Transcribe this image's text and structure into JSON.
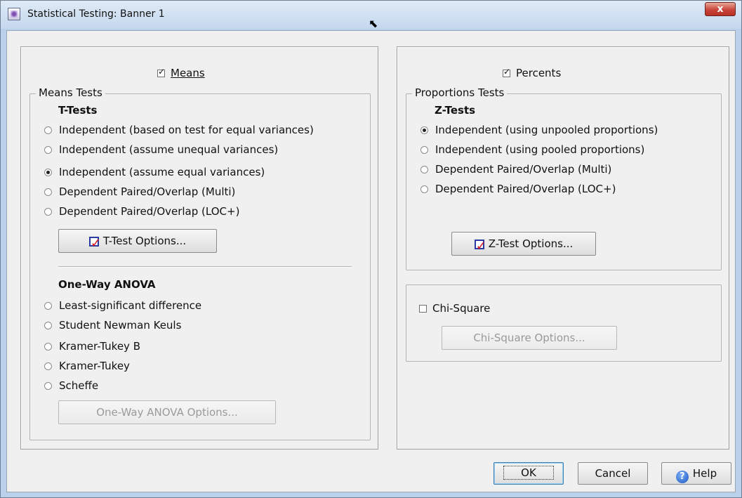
{
  "window": {
    "title": "Statistical Testing: Banner 1",
    "close_label": "x"
  },
  "means": {
    "checkbox_label": "Means",
    "checked": true,
    "group_title": "Means Tests",
    "ttests": {
      "heading": "T-Tests",
      "options": [
        {
          "label": "Independent (based on test for equal variances)",
          "selected": false
        },
        {
          "label": "Independent (assume unequal variances)",
          "selected": false
        },
        {
          "label": "Independent (assume equal variances)",
          "selected": true
        },
        {
          "label": "Dependent Paired/Overlap (Multi)",
          "selected": false
        },
        {
          "label": "Dependent Paired/Overlap (LOC+)",
          "selected": false
        }
      ],
      "options_button": "T-Test Options..."
    },
    "anova": {
      "heading": "One-Way ANOVA",
      "options": [
        {
          "label": "Least-significant difference",
          "selected": false
        },
        {
          "label": "Student Newman Keuls",
          "selected": false
        },
        {
          "label": "Kramer-Tukey B",
          "selected": false
        },
        {
          "label": "Kramer-Tukey",
          "selected": false
        },
        {
          "label": "Scheffe",
          "selected": false
        }
      ],
      "options_button": "One-Way ANOVA Options..."
    }
  },
  "percents": {
    "checkbox_label": "Percents",
    "checked": true,
    "group_title": "Proportions Tests",
    "ztests": {
      "heading": "Z-Tests",
      "options": [
        {
          "label": "Independent (using unpooled proportions)",
          "selected": true
        },
        {
          "label": "Independent (using pooled proportions)",
          "selected": false
        },
        {
          "label": "Dependent Paired/Overlap (Multi)",
          "selected": false
        },
        {
          "label": "Dependent Paired/Overlap (LOC+)",
          "selected": false
        }
      ],
      "options_button": "Z-Test Options..."
    }
  },
  "chisquare": {
    "checkbox_label": "Chi-Square",
    "checked": false,
    "options_button": "Chi-Square Options..."
  },
  "footer": {
    "ok": "OK",
    "cancel": "Cancel",
    "help": "Help"
  }
}
